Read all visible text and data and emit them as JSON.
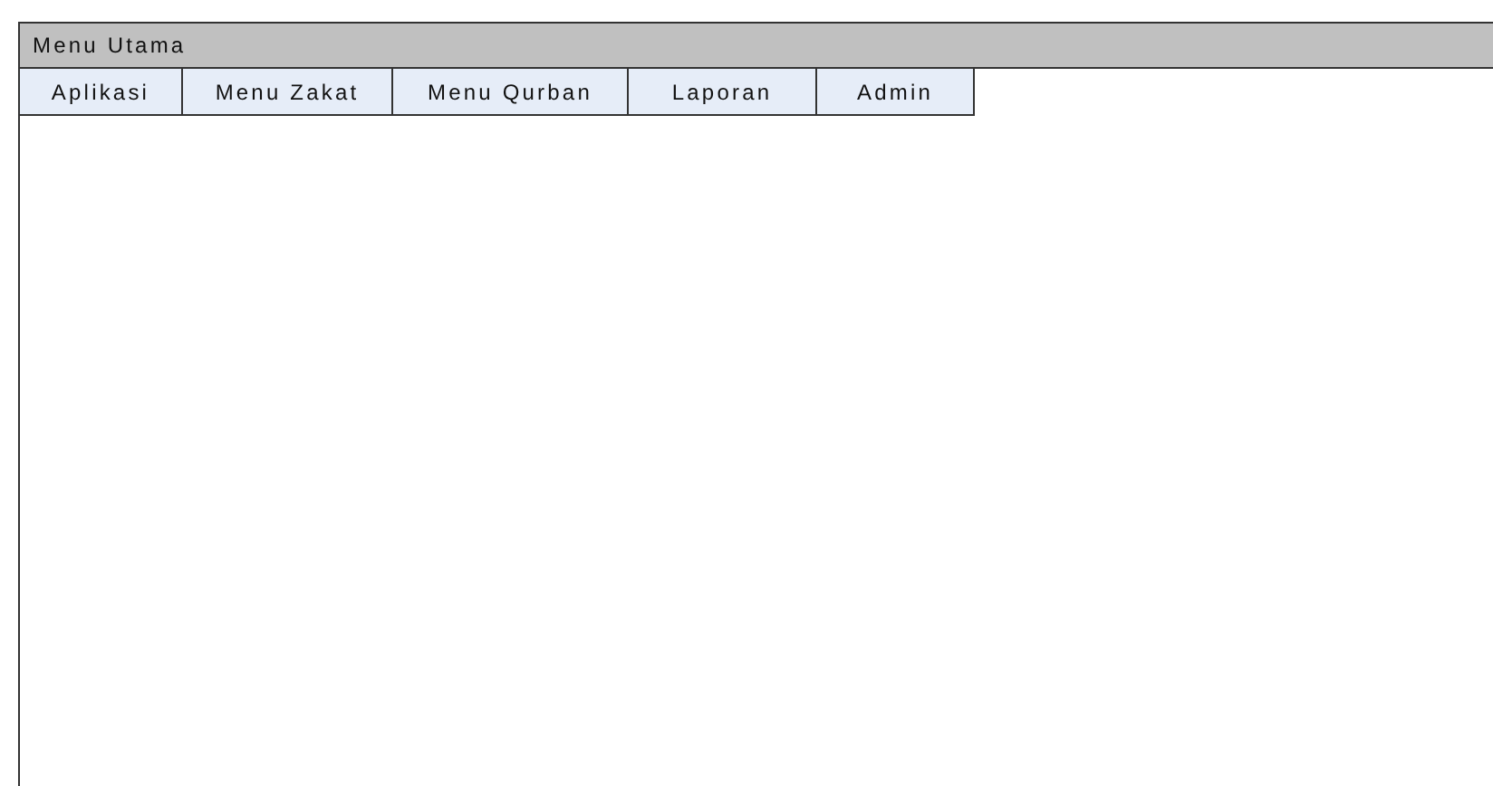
{
  "window": {
    "title": "Menu Utama"
  },
  "menu_bar": [
    {
      "label": "Aplikasi"
    },
    {
      "label": "Menu Zakat"
    },
    {
      "label": "Menu Qurban"
    },
    {
      "label": "Laporan"
    },
    {
      "label": "Admin"
    }
  ]
}
